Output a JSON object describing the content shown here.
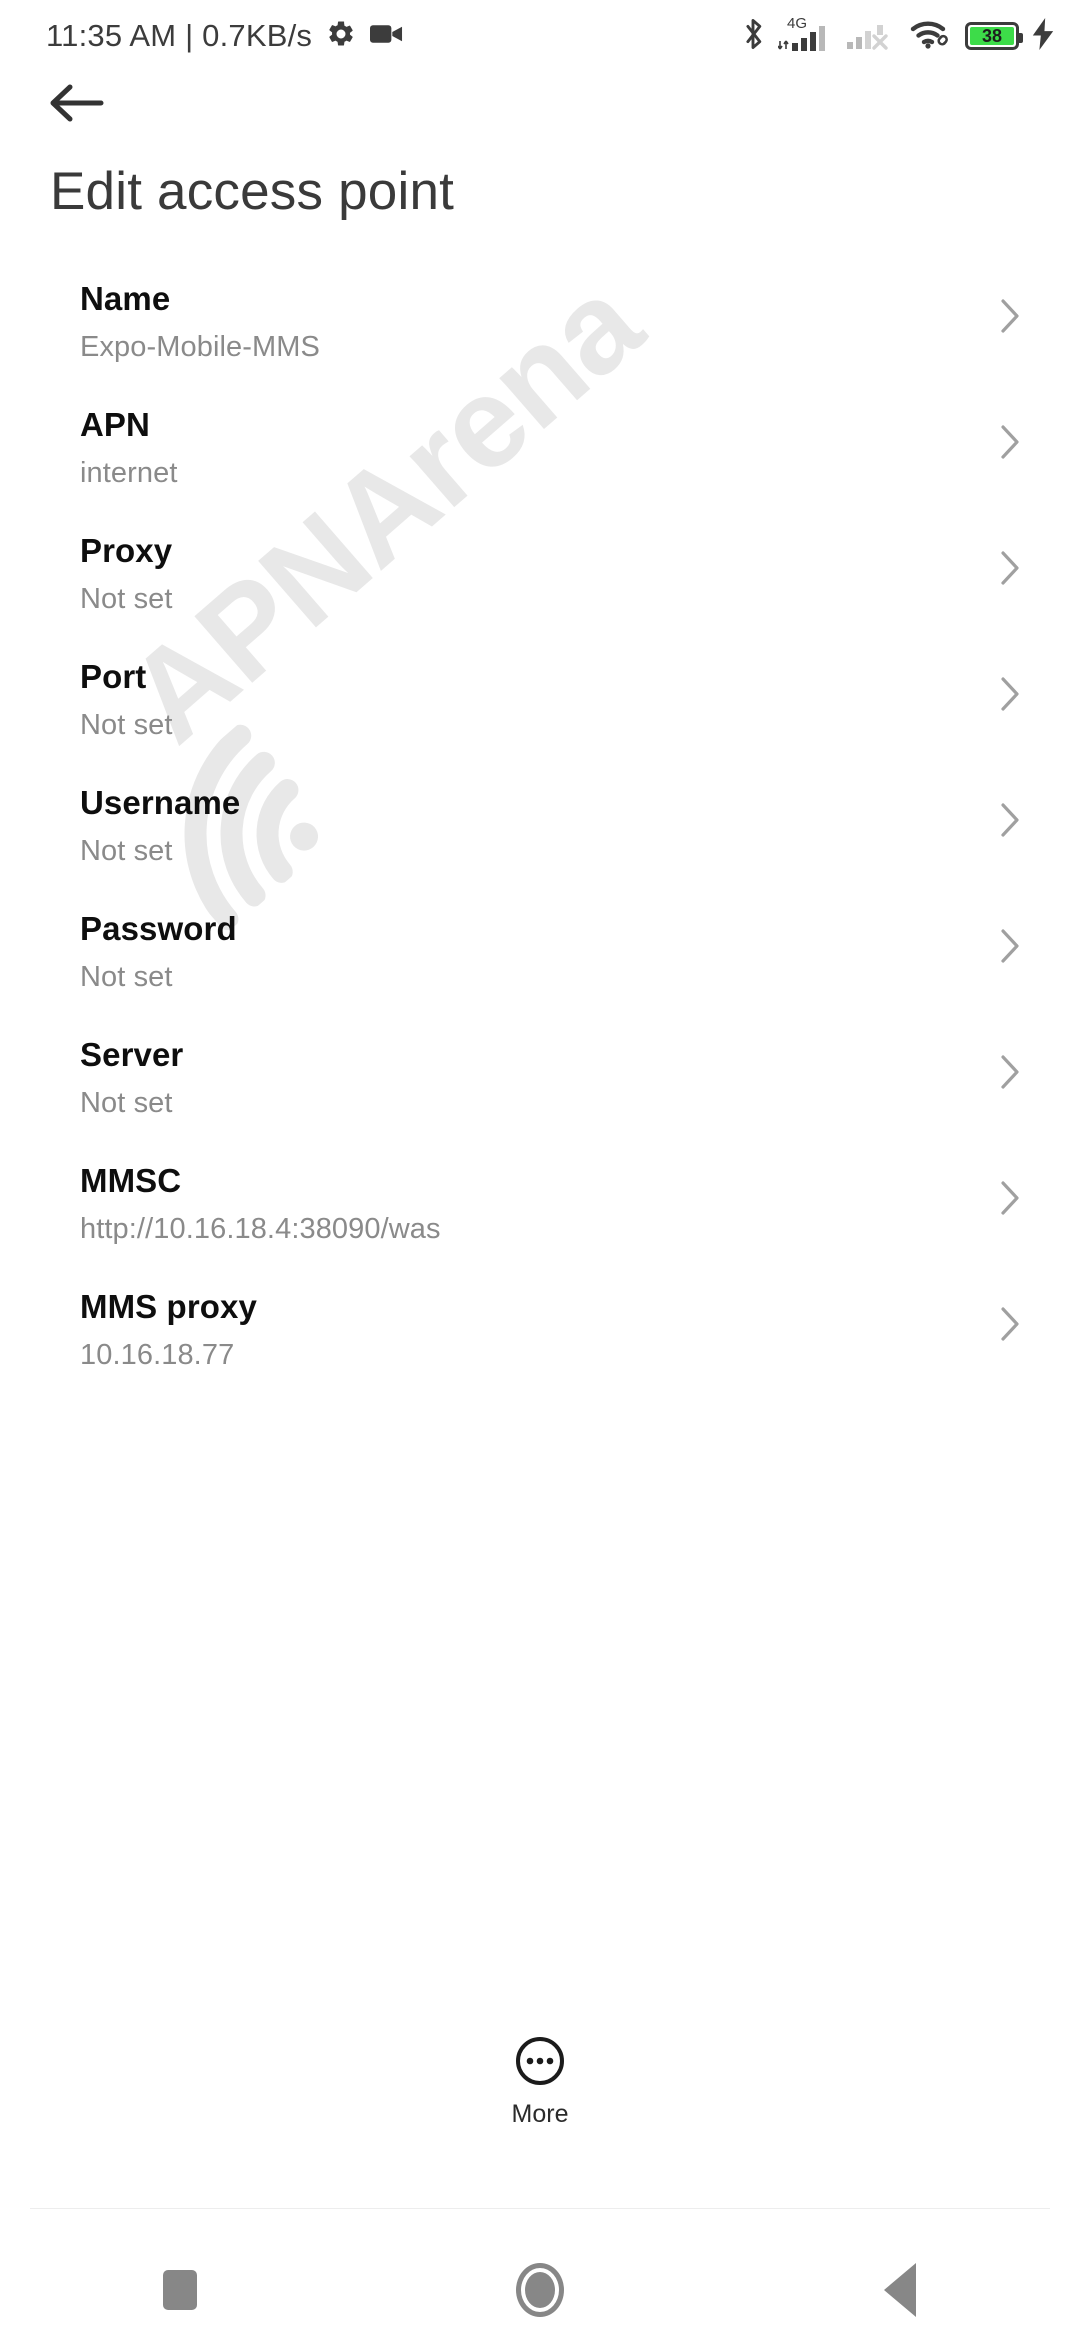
{
  "status_bar": {
    "clock_and_speed": "11:35 AM | 0.7KB/s",
    "network_label": "4G",
    "battery_percent": "38",
    "icons": [
      "settings-gear-icon",
      "video-camera-icon",
      "bluetooth-icon",
      "signal-sim1-icon",
      "signal-sim2-no-service-icon",
      "wifi-icon",
      "battery-icon",
      "charging-bolt-icon"
    ],
    "colors": {
      "foreground": "#3c3c3c",
      "battery_fill": "#3ddc49"
    }
  },
  "header": {
    "back_label": "back-arrow",
    "title": "Edit access point"
  },
  "watermark": {
    "text": "APNArena",
    "color": "#e8e8e8"
  },
  "settings_list": [
    {
      "title": "Name",
      "value": "Expo-Mobile-MMS"
    },
    {
      "title": "APN",
      "value": "internet"
    },
    {
      "title": "Proxy",
      "value": "Not set"
    },
    {
      "title": "Port",
      "value": "Not set"
    },
    {
      "title": "Username",
      "value": "Not set"
    },
    {
      "title": "Password",
      "value": "Not set"
    },
    {
      "title": "Server",
      "value": "Not set"
    },
    {
      "title": "MMSC",
      "value": "http://10.16.18.4:38090/was"
    },
    {
      "title": "MMS proxy",
      "value": "10.16.18.77"
    }
  ],
  "more_button": {
    "label": "More"
  },
  "nav_bar": {
    "recents_label": "recents",
    "home_label": "home",
    "back_label": "back"
  }
}
